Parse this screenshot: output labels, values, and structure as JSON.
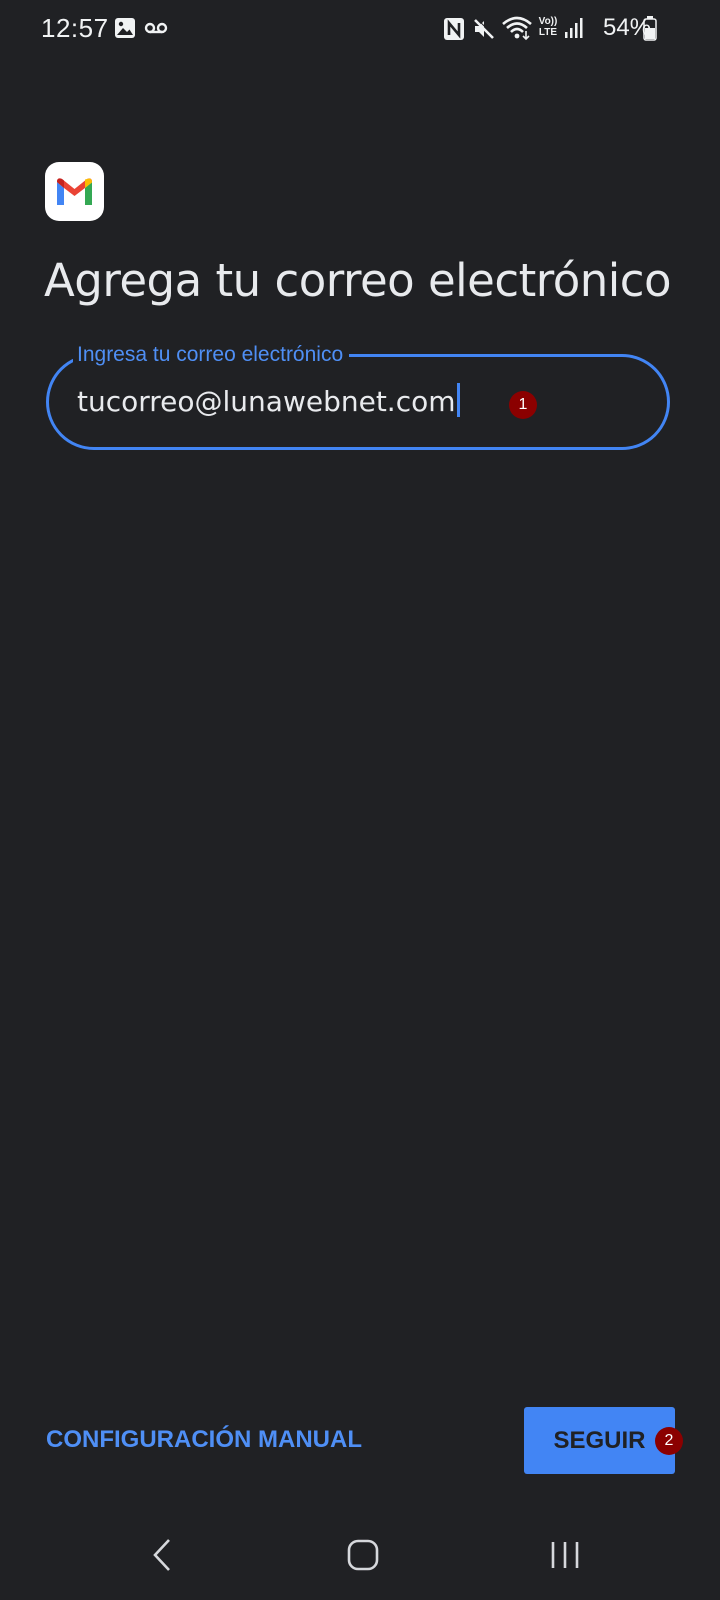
{
  "status_bar": {
    "time": "12:57",
    "battery": "54%",
    "icons": [
      "gallery-icon",
      "voicemail-icon",
      "nfc-icon",
      "mute-icon",
      "wifi-icon",
      "volte-icon",
      "signal-icon",
      "battery-icon"
    ],
    "volte_label": "Vo)) LTE"
  },
  "app": {
    "logo": "gmail-logo",
    "brand_colors": {
      "blue": "#4285F4",
      "red": "#EA4335",
      "yellow": "#FBBC04",
      "green": "#34A853"
    }
  },
  "page": {
    "title": "Agrega tu correo electrónico"
  },
  "email_input": {
    "label": "Ingresa tu correo electrónico",
    "value": "tucorreo@lunawebnet.com"
  },
  "markers": {
    "one": "1",
    "two": "2"
  },
  "actions": {
    "manual_config_label": "CONFIGURACIÓN MANUAL",
    "next_label": "SEGUIR"
  },
  "navigation": {
    "buttons": [
      "back-icon",
      "home-icon",
      "recent-apps-icon"
    ]
  },
  "colors": {
    "background": "#202124",
    "accent": "#4285F4",
    "marker": "#8B0000"
  }
}
